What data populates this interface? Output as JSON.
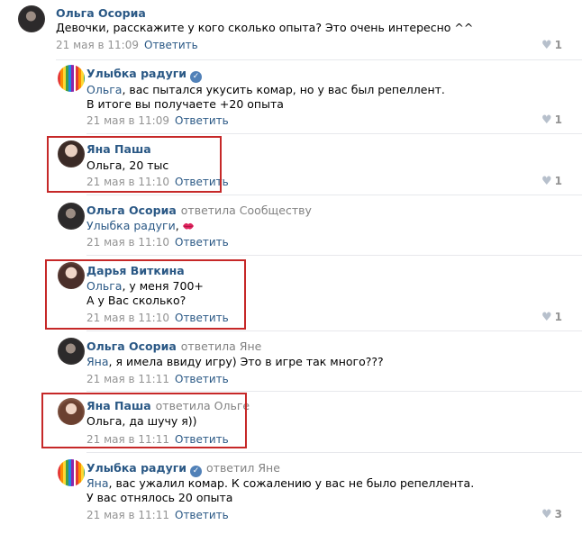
{
  "reply_label": "Ответить",
  "comments": [
    {
      "author": "Ольга Осориа",
      "lines": [
        "Девочки, расскажите у кого сколько опыта? Это очень интересно ^^"
      ],
      "date": "21 мая в 11:09",
      "likes": "1"
    },
    {
      "author": "Улыбка радуги",
      "mention": "Ольга",
      "lines": [
        ", вас пытался укусить комар, но у вас был репеллент.",
        "В итоге вы получаете +20 опыта"
      ],
      "date": "21 мая в 11:09",
      "likes": "1"
    },
    {
      "author": "Яна Паша",
      "lines": [
        "Ольга, 20 тыс"
      ],
      "date": "21 мая в 11:10",
      "likes": "1"
    },
    {
      "author": "Ольга Осориа",
      "reply_to": "ответила Сообществу",
      "mention": "Улыбка радуги",
      "after_mention": ",",
      "date": "21 мая в 11:10"
    },
    {
      "author": "Дарья Виткина",
      "mention": "Ольга",
      "lines": [
        ", у меня 700+",
        "А у Вас сколько?"
      ],
      "date": "21 мая в 11:10",
      "likes": "1"
    },
    {
      "author": "Ольга Осориа",
      "reply_to": "ответила Яне",
      "mention": "Яна",
      "lines": [
        ", я имела ввиду игру) Это в игре так много???"
      ],
      "date": "21 мая в 11:11"
    },
    {
      "author": "Яна Паша",
      "reply_to": "ответила Ольге",
      "lines": [
        "Ольга, да шучу я))"
      ],
      "date": "21 мая в 11:11"
    },
    {
      "author": "Улыбка радуги",
      "reply_to": "ответил Яне",
      "mention": "Яна",
      "lines": [
        ", вас ужалил комар. К сожалению у вас не было репеллента.",
        "У вас отнялось 20 опыта"
      ],
      "date": "21 мая в 11:11",
      "likes": "3"
    }
  ],
  "icons": {
    "heart": "heart-icon",
    "verified": "verified-check-icon",
    "lips": "kiss-lips-icon"
  },
  "colors": {
    "link": "#2a5885",
    "meta": "#939393",
    "highlight": "#c62828"
  }
}
